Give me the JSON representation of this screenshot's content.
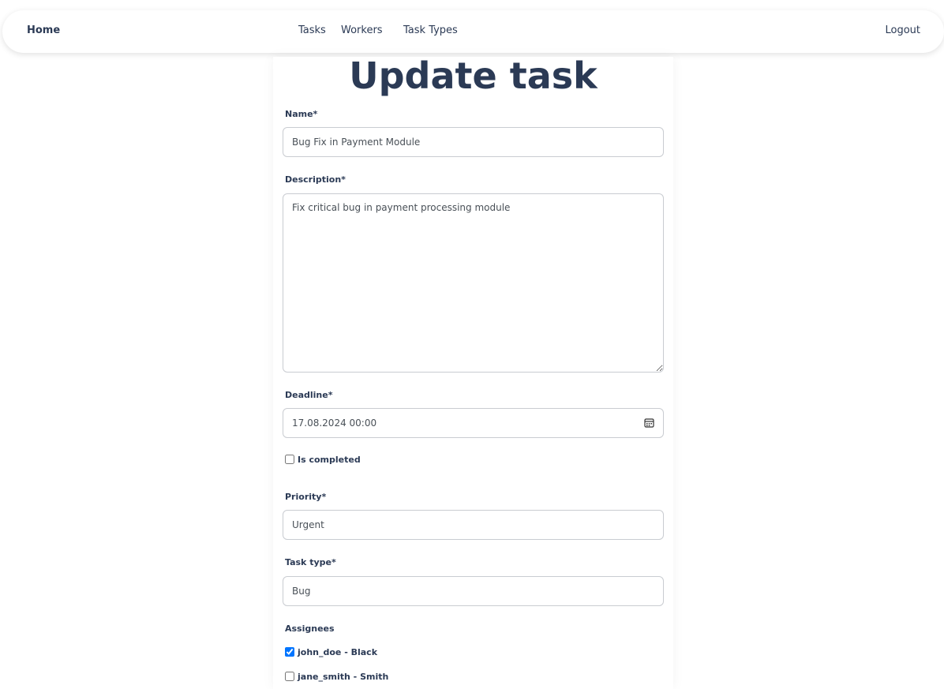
{
  "nav": {
    "home": "Home",
    "links": [
      "Tasks",
      "Workers",
      "Task Types"
    ],
    "logout": "Logout"
  },
  "form": {
    "title": "Update task",
    "name_label": "Name*",
    "name_value": "Bug Fix in Payment Module",
    "description_label": "Description*",
    "description_value": "Fix critical bug in payment processing module",
    "deadline_label": "Deadline*",
    "deadline_value": "17.08.2024 00:00",
    "is_completed_label": "Is completed",
    "is_completed_checked": false,
    "priority_label": "Priority*",
    "priority_value": "Urgent",
    "task_type_label": "Task type*",
    "task_type_value": "Bug",
    "assignees_label": "Assignees",
    "assignees": [
      {
        "label": "john_doe - Black",
        "checked": true
      },
      {
        "label": "jane_smith - Smith",
        "checked": false
      }
    ]
  },
  "colors": {
    "text": "#2b3a55",
    "border": "#c9ccd1"
  },
  "icons": {
    "deadline": "calendar-icon"
  }
}
